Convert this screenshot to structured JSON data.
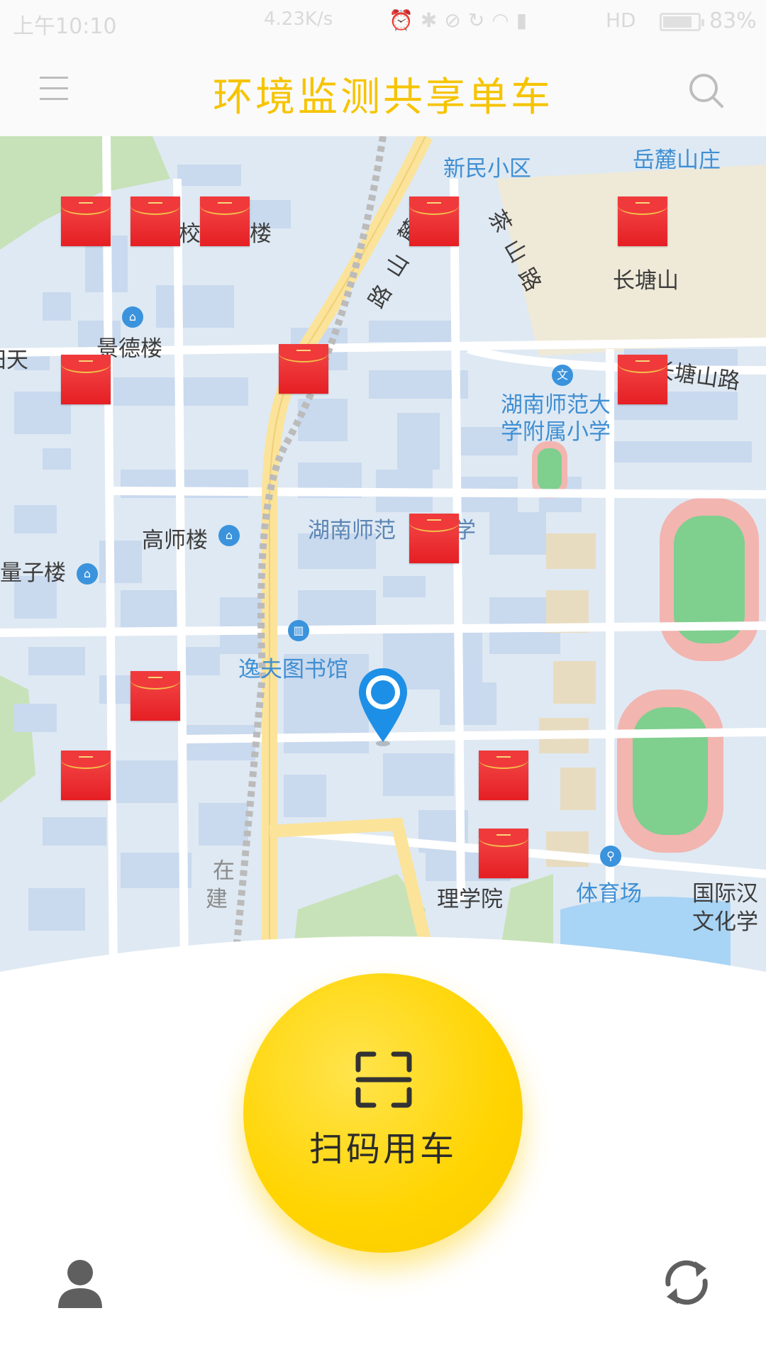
{
  "status_bar": {
    "time": "上午10:10",
    "network_speed": "4.23K/s",
    "signal_label": "HD",
    "battery_percent": "83%",
    "battery_level": 0.83,
    "icons": [
      "alarm-icon",
      "bluetooth-icon",
      "mute-icon",
      "sync-icon",
      "wifi-icon",
      "signal-icon"
    ]
  },
  "app_bar": {
    "title": "环境监测共享单车",
    "menu_icon": "menu-icon",
    "search_icon": "search-icon",
    "title_color": "#f6c400"
  },
  "map": {
    "labels": {
      "xinmin": "新民小区",
      "yuelu_shanzhuang": "岳麓山庄",
      "xiao": "校",
      "lou": "楼",
      "changtangshan": "长塘山",
      "jingde_building": "景德楼",
      "tian": "田天",
      "changtangshan_road": "长塘山路",
      "attached_school": "湖南师范大\n学附属小学",
      "gaoshi_building": "高师楼",
      "hunan_normal": "湖南师范",
      "xue": "学",
      "liangzi_building": "量子楼",
      "yifu_library": "逸夫图书馆",
      "science_college": "理学院",
      "stadium": "体育场",
      "international": "国际汉",
      "culture": "文化学",
      "zai": "在",
      "jian": "建",
      "road_lu_1": "麓",
      "road_lu_2": "山",
      "road_lu_3": "路",
      "cha": "茶",
      "cha_shan": "山",
      "cha_lu": "路"
    },
    "poi_icons": [
      "school-poi-icon",
      "library-poi-icon",
      "stadium-poi-icon",
      "education-poi-icon"
    ],
    "red_envelope_count": 13,
    "colors": {
      "map_bg": "#dfe9f3",
      "building": "#c9d9ee",
      "road": "#ffffff",
      "main_road": "#fbe39a",
      "green": "#c7e2b8",
      "track": "#f2b5b0",
      "water": "#a8d4f5"
    }
  },
  "scan_button": {
    "label": "扫码用车",
    "icon": "scan-qr-icon",
    "color": "#ffd400"
  },
  "bottom_bar": {
    "user_icon": "user-icon",
    "refresh_icon": "refresh-icon"
  }
}
